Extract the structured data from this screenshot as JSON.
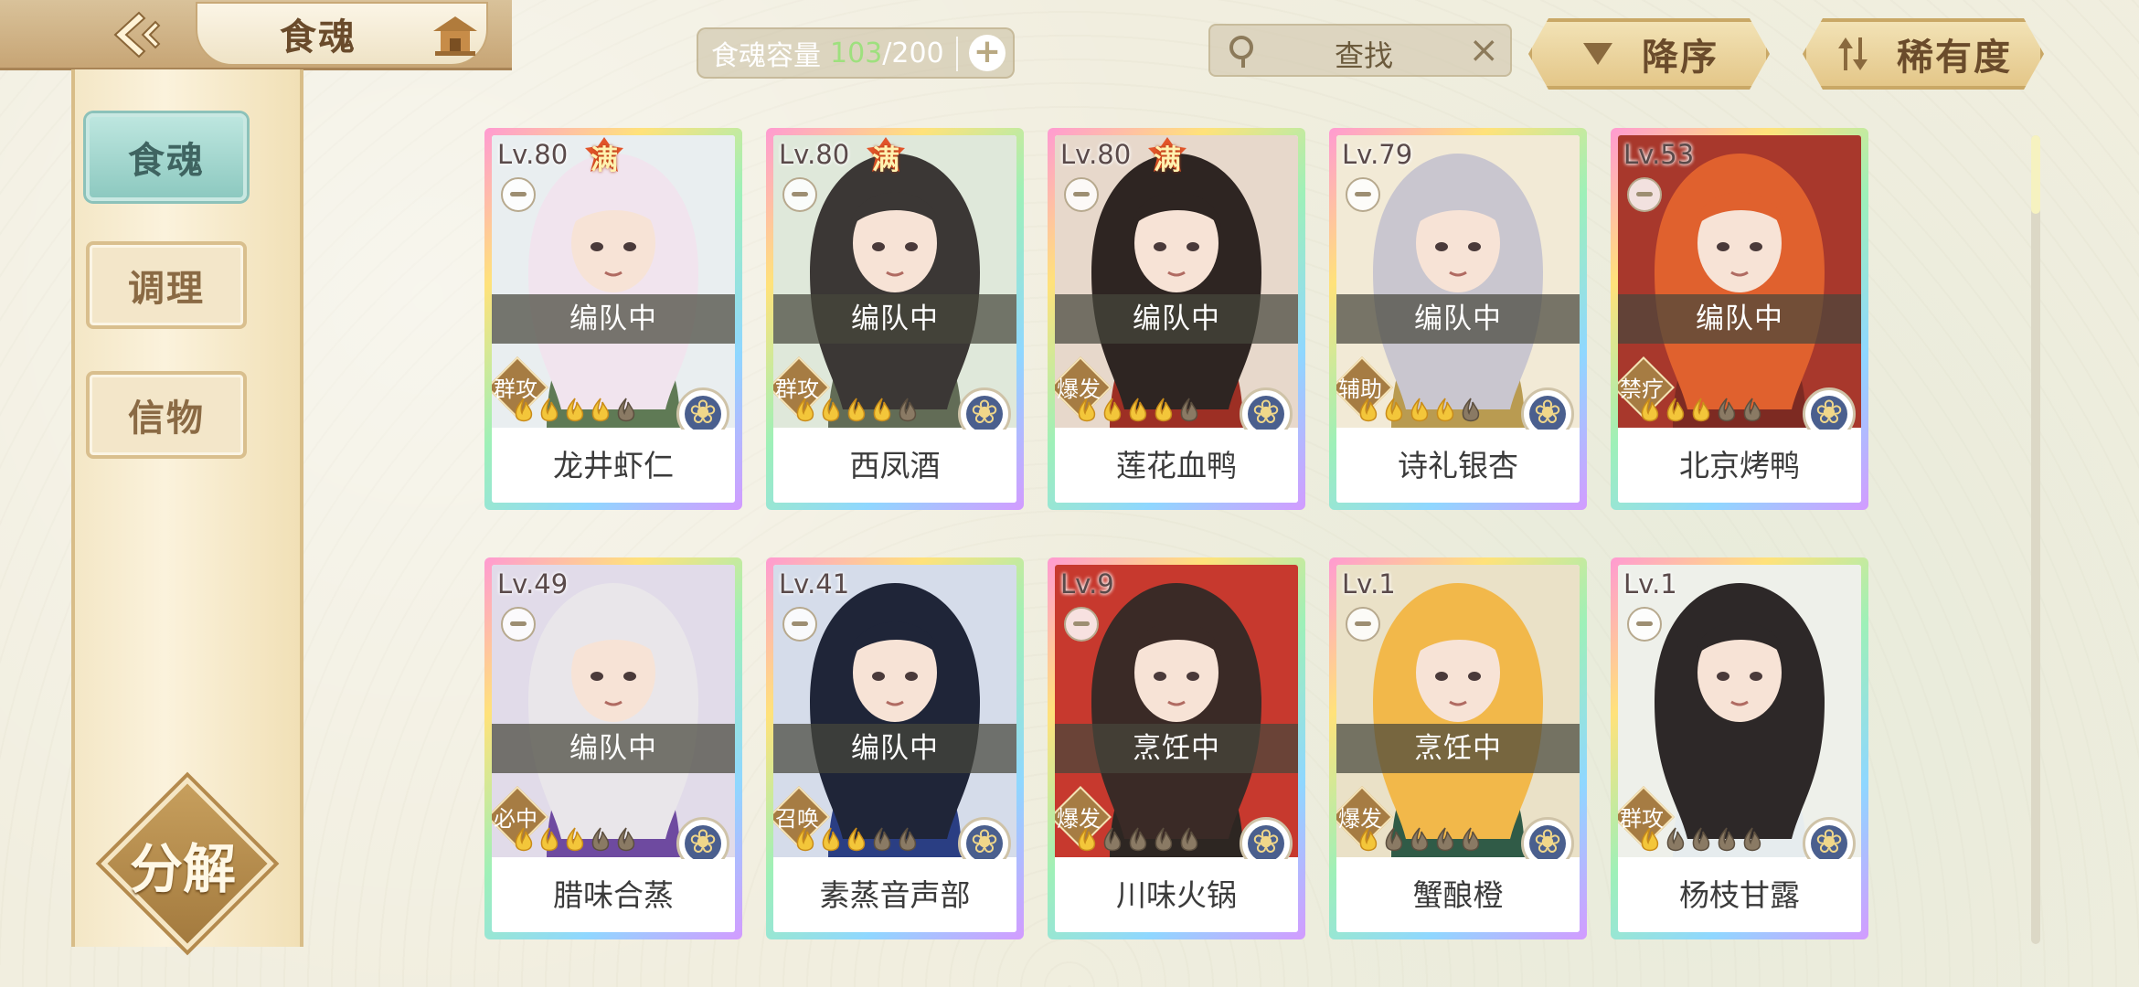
{
  "header": {
    "title": "食魂",
    "capacity": {
      "label": "食魂容量",
      "current": "103",
      "max": "/200"
    },
    "search_placeholder": "查找",
    "sort_order": "降序",
    "sort_by": "稀有度"
  },
  "sidebar": {
    "items": [
      {
        "label": "食魂",
        "active": true
      },
      {
        "label": "调理",
        "active": false
      },
      {
        "label": "信物",
        "active": false
      }
    ],
    "decompose_label": "分解"
  },
  "cards": [
    {
      "level": "Lv.80",
      "full": "满",
      "status": "编队中",
      "role": "群攻",
      "name": "龙井虾仁",
      "stars_lit": 4,
      "hair": "#f1e4ee",
      "cloth": "#5f7a55",
      "bg": "#e9eef0"
    },
    {
      "level": "Lv.80",
      "full": "满",
      "status": "编队中",
      "role": "群攻",
      "name": "西凤酒",
      "stars_lit": 4,
      "hair": "#3b3735",
      "cloth": "#626c56",
      "bg": "#dfe8da"
    },
    {
      "level": "Lv.80",
      "full": "满",
      "status": "编队中",
      "role": "爆发",
      "name": "莲花血鸭",
      "stars_lit": 4,
      "hair": "#2e2522",
      "cloth": "#9d2f24",
      "bg": "#e7d8cb"
    },
    {
      "level": "Lv.79",
      "full": "",
      "status": "编队中",
      "role": "辅助",
      "name": "诗礼银杏",
      "stars_lit": 4,
      "hair": "#c9c6cf",
      "cloth": "#b99b51",
      "bg": "#f2ead6"
    },
    {
      "level": "Lv.53",
      "full": "",
      "status": "编队中",
      "role": "禁疗",
      "name": "北京烤鸭",
      "stars_lit": 3,
      "hair": "#e0612e",
      "cloth": "#7d2a22",
      "bg": "#a8382c"
    },
    {
      "level": "Lv.49",
      "full": "",
      "status": "编队中",
      "role": "必中",
      "name": "腊味合蒸",
      "stars_lit": 3,
      "hair": "#e9e6ea",
      "cloth": "#6e4aa0",
      "bg": "#e1dbe9"
    },
    {
      "level": "Lv.41",
      "full": "",
      "status": "编队中",
      "role": "召唤",
      "name": "素蒸音声部",
      "stars_lit": 3,
      "hair": "#1f2538",
      "cloth": "#2a3e83",
      "bg": "#d5dcea"
    },
    {
      "level": "Lv.9",
      "full": "",
      "status": "烹饪中",
      "role": "爆发",
      "name": "川味火锅",
      "stars_lit": 1,
      "hair": "#3a2a26",
      "cloth": "#2d2622",
      "bg": "#c7392e"
    },
    {
      "level": "Lv.1",
      "full": "",
      "status": "烹饪中",
      "role": "爆发",
      "name": "蟹酿橙",
      "stars_lit": 1,
      "hair": "#f2b84a",
      "cloth": "#305b47",
      "bg": "#eae1c7"
    },
    {
      "level": "Lv.1",
      "full": "",
      "status": "",
      "role": "群攻",
      "name": "杨枝甘露",
      "stars_lit": 1,
      "hair": "#2d2828",
      "cloth": "#e6ecee",
      "bg": "#eef0ea"
    }
  ]
}
